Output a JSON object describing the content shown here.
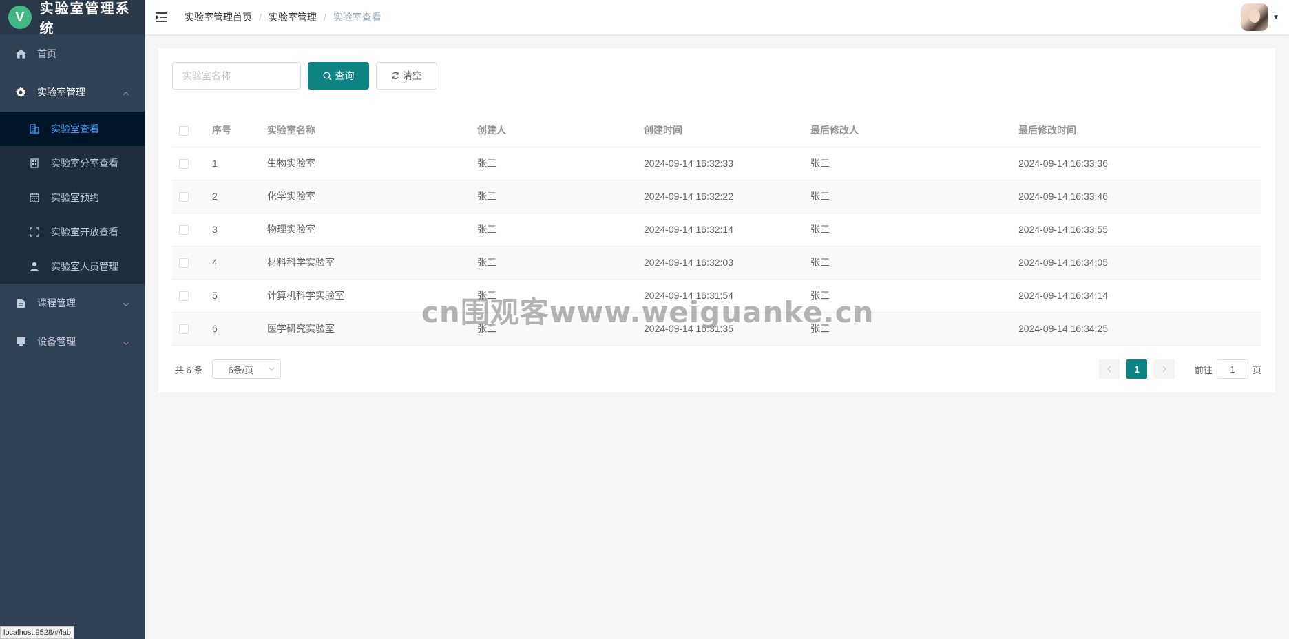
{
  "app": {
    "logo_letter": "V",
    "title": "实验室管理系统"
  },
  "sidebar": {
    "home": "首页",
    "lab_mgmt": "实验室管理",
    "lab_sub": [
      "实验室查看",
      "实验室分室查看",
      "实验室预约",
      "实验室开放查看",
      "实验室人员管理"
    ],
    "course_mgmt": "课程管理",
    "device_mgmt": "设备管理"
  },
  "breadcrumb": [
    "实验室管理首页",
    "实验室管理",
    "实验室查看"
  ],
  "search": {
    "placeholder": "实验室名称",
    "query_label": "查询",
    "clear_label": "清空"
  },
  "table": {
    "headers": [
      "序号",
      "实验室名称",
      "创建人",
      "创建时间",
      "最后修改人",
      "最后修改时间"
    ],
    "rows": [
      [
        "1",
        "生物实验室",
        "张三",
        "2024-09-14 16:32:33",
        "张三",
        "2024-09-14 16:33:36"
      ],
      [
        "2",
        "化学实验室",
        "张三",
        "2024-09-14 16:32:22",
        "张三",
        "2024-09-14 16:33:46"
      ],
      [
        "3",
        "物理实验室",
        "张三",
        "2024-09-14 16:32:14",
        "张三",
        "2024-09-14 16:33:55"
      ],
      [
        "4",
        "材料科学实验室",
        "张三",
        "2024-09-14 16:32:03",
        "张三",
        "2024-09-14 16:34:05"
      ],
      [
        "5",
        "计算机科学实验室",
        "张三",
        "2024-09-14 16:31:54",
        "张三",
        "2024-09-14 16:34:14"
      ],
      [
        "6",
        "医学研究实验室",
        "张三",
        "2024-09-14 16:31:35",
        "张三",
        "2024-09-14 16:34:25"
      ]
    ]
  },
  "pagination": {
    "total": "共 6 条",
    "page_size": "6条/页",
    "current_page": "1",
    "goto_prefix": "前往",
    "goto_value": "1",
    "goto_suffix": "页"
  },
  "status_tip": "localhost:9528/#/lab",
  "watermark": "cn围观客www.weiguanke.cn",
  "colors": {
    "sidebar_bg": "#304156",
    "submenu_bg": "#1f2d3d",
    "active_item_bg": "#001528",
    "active_text": "#409eff",
    "primary": "#0e8383"
  }
}
